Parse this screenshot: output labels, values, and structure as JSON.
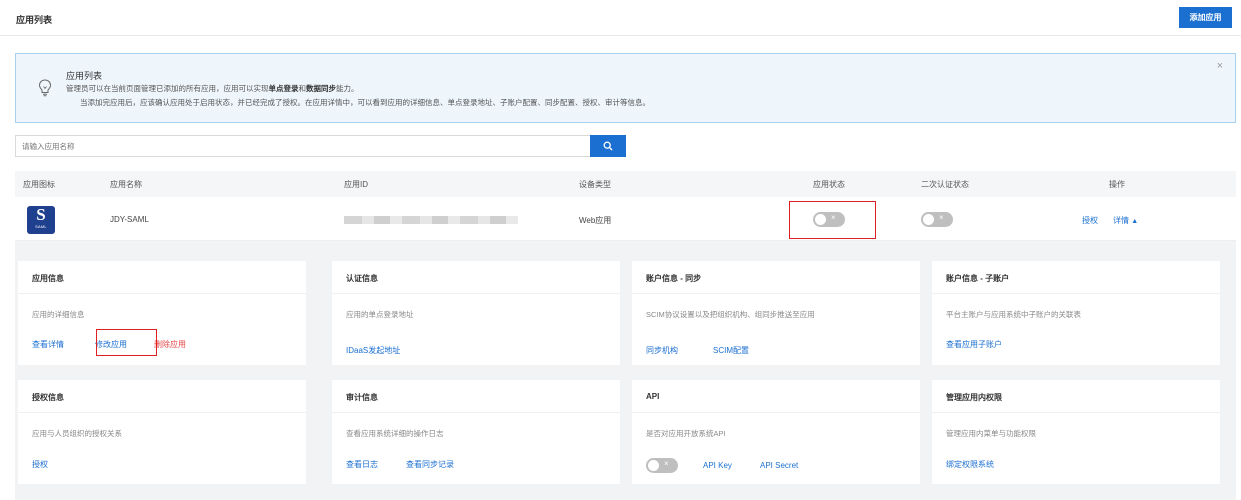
{
  "header": {
    "title": "应用列表",
    "add_button": "添加应用"
  },
  "notice": {
    "title": "应用列表",
    "line1_prefix": "管理员可以在当前页面管理已添加的所有应用，应用可以实现",
    "line1_bold1": "单点登录",
    "line1_mid": "和",
    "line1_bold2": "数据同步",
    "line1_suffix": "能力。",
    "line2": "当添加完应用后，应该确认应用处于启用状态，并已经完成了授权。在应用详情中，可以看到应用的详细信息、单点登录地址、子账户配置、同步配置、授权、审计等信息。",
    "close": "×"
  },
  "search": {
    "placeholder": "请输入应用名称"
  },
  "table": {
    "columns": [
      "应用图标",
      "应用名称",
      "应用ID",
      "设备类型",
      "应用状态",
      "二次认证状态",
      "操作"
    ],
    "row": {
      "icon_letter": "S",
      "icon_sub": "SAML",
      "name": "JDY-SAML",
      "device_type": "Web应用",
      "app_status": "off",
      "mfa_status": "off",
      "action_auth": "授权",
      "action_detail": "详情"
    }
  },
  "cards": [
    {
      "title": "应用信息",
      "desc": "应用的详细信息",
      "links": [
        "查看详情",
        "修改应用",
        "删除应用"
      ]
    },
    {
      "title": "认证信息",
      "desc": "应用的单点登录地址",
      "links": [
        "IDaaS发起地址"
      ]
    },
    {
      "title": "账户信息 - 同步",
      "desc": "SCIM协议设置以及把组织机构、组同步推送至应用",
      "links": [
        "同步机构",
        "SCIM配置"
      ]
    },
    {
      "title": "账户信息 - 子账户",
      "desc": "平台主账户与应用系统中子账户的关联表",
      "links": [
        "查看应用子账户"
      ]
    },
    {
      "title": "授权信息",
      "desc": "应用与人员组织的授权关系",
      "links": [
        "授权"
      ]
    },
    {
      "title": "审计信息",
      "desc": "查看应用系统详细的操作日志",
      "links": [
        "查看日志",
        "查看同步记录"
      ]
    },
    {
      "title": "API",
      "desc": "是否对应用开放系统API",
      "links": [
        "API Key",
        "API Secret"
      ]
    },
    {
      "title": "管理应用内权限",
      "desc": "管理应用内菜单与功能权限",
      "links": [
        "绑定权限系统"
      ]
    }
  ],
  "colors": {
    "primary": "#1a6fd0",
    "danger": "#e64545",
    "highlight": "#e02020"
  }
}
